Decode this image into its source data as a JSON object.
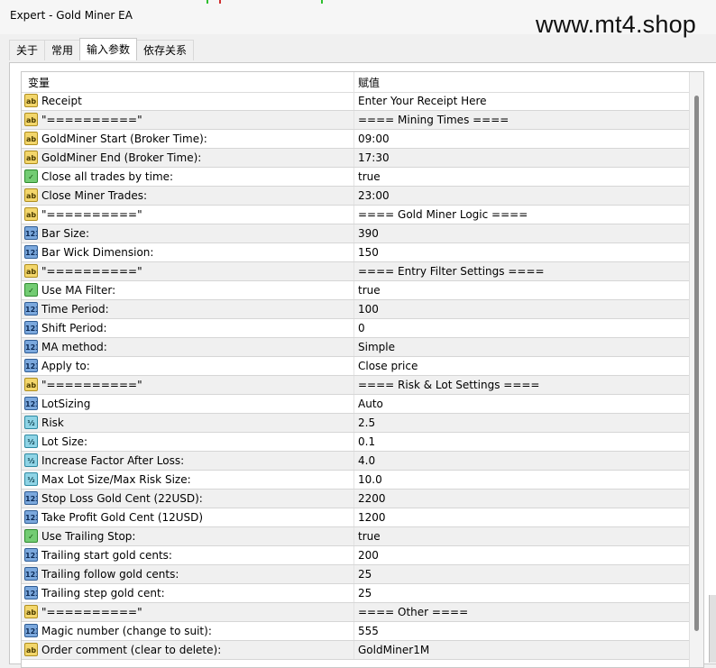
{
  "window": {
    "title": "Expert - Gold Miner EA"
  },
  "watermark": "www.mt4.shop",
  "tabs": [
    {
      "label": "关于",
      "active": false
    },
    {
      "label": "常用",
      "active": false
    },
    {
      "label": "输入参数",
      "active": true
    },
    {
      "label": "依存关系",
      "active": false
    }
  ],
  "grid": {
    "col_variable": "变量",
    "col_value": "赋值",
    "rows": [
      {
        "type": "ab",
        "name": "Receipt",
        "value": "Enter Your Receipt Here"
      },
      {
        "type": "ab",
        "name": "\"==========\"",
        "value": "==== Mining Times ===="
      },
      {
        "type": "ab",
        "name": "GoldMiner Start (Broker Time):",
        "value": "09:00"
      },
      {
        "type": "ab",
        "name": "GoldMiner End (Broker Time):",
        "value": "17:30"
      },
      {
        "type": "bool",
        "name": "Close all trades by time:",
        "value": "true"
      },
      {
        "type": "ab",
        "name": "Close Miner Trades:",
        "value": "23:00"
      },
      {
        "type": "ab",
        "name": "\"==========\"",
        "value": "==== Gold Miner Logic ===="
      },
      {
        "type": "123",
        "name": "Bar Size:",
        "value": "390"
      },
      {
        "type": "123",
        "name": "Bar Wick Dimension:",
        "value": "150"
      },
      {
        "type": "ab",
        "name": "\"==========\"",
        "value": "==== Entry Filter Settings ===="
      },
      {
        "type": "bool",
        "name": "Use MA Filter:",
        "value": "true"
      },
      {
        "type": "123",
        "name": "Time Period:",
        "value": "100"
      },
      {
        "type": "123",
        "name": "Shift Period:",
        "value": "0"
      },
      {
        "type": "123",
        "name": "MA method:",
        "value": "Simple"
      },
      {
        "type": "123",
        "name": "Apply to:",
        "value": "Close price"
      },
      {
        "type": "ab",
        "name": "\"==========\"",
        "value": "==== Risk & Lot Settings ===="
      },
      {
        "type": "123",
        "name": "LotSizing",
        "value": "Auto"
      },
      {
        "type": "v2",
        "name": "Risk",
        "value": "2.5"
      },
      {
        "type": "v2",
        "name": "Lot Size:",
        "value": "0.1"
      },
      {
        "type": "v2",
        "name": "Increase Factor After Loss:",
        "value": "4.0"
      },
      {
        "type": "v2",
        "name": "Max Lot Size/Max Risk Size:",
        "value": "10.0"
      },
      {
        "type": "123",
        "name": "Stop Loss Gold Cent (22USD):",
        "value": "2200"
      },
      {
        "type": "123",
        "name": "Take Profit Gold Cent (12USD)",
        "value": "1200"
      },
      {
        "type": "bool",
        "name": "Use Trailing Stop:",
        "value": "true"
      },
      {
        "type": "123",
        "name": "Trailing start gold cents:",
        "value": "200"
      },
      {
        "type": "123",
        "name": "Trailing follow gold cents:",
        "value": "25"
      },
      {
        "type": "123",
        "name": "Trailing step gold cent:",
        "value": "25"
      },
      {
        "type": "ab",
        "name": "\"==========\"",
        "value": "==== Other  ===="
      },
      {
        "type": "123",
        "name": "Magic number (change to suit):",
        "value": "555"
      },
      {
        "type": "ab",
        "name": "Order comment (clear to delete):",
        "value": "GoldMiner1M"
      }
    ]
  },
  "icons": {
    "ab": {
      "name": "string-type-icon",
      "glyph": "ab"
    },
    "123": {
      "name": "integer-type-icon",
      "glyph": "123"
    },
    "bool": {
      "name": "boolean-type-icon",
      "glyph": "✓"
    },
    "v2": {
      "name": "double-type-icon",
      "glyph": "½"
    }
  }
}
